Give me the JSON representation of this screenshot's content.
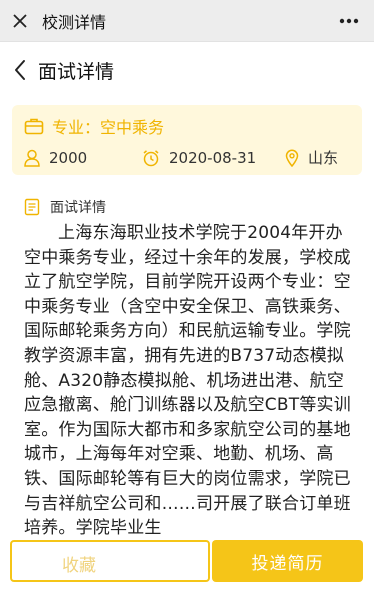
{
  "topbar": {
    "title": "校测详情"
  },
  "header": {
    "title": "面试详情"
  },
  "card": {
    "major_label": "专业：空中乘务",
    "count": "2000",
    "date": "2020-08-31",
    "location": "山东"
  },
  "section": {
    "title": "面试详情",
    "text": "上海东海职业技术学院于2004年开办空中乘务专业，经过十余年的发展，学校成立了航空学院，目前学院开设两个专业：空中乘务专业（含空中安全保卫、高铁乘务、国际邮轮乘务方向）和民航运输专业。学院教学资源丰富，拥有先进的B737动态模拟舱、A320静态模拟舱、机场进出港、航空应急撤离、舱门训练器以及航空CBT等实训室。作为国际大都市和多家航空公司的基地城市，上海每年对空乘、地勤、机场、高铁、国际邮轮等有巨大的岗位需求，学院已与吉祥航空公司和……司开展了联合订单班培养。学院毕业生"
  },
  "footer": {
    "left_label": "收藏",
    "apply_label": "投递简历"
  },
  "colors": {
    "accent": "#f5c518",
    "accent_text": "#f0b400"
  }
}
